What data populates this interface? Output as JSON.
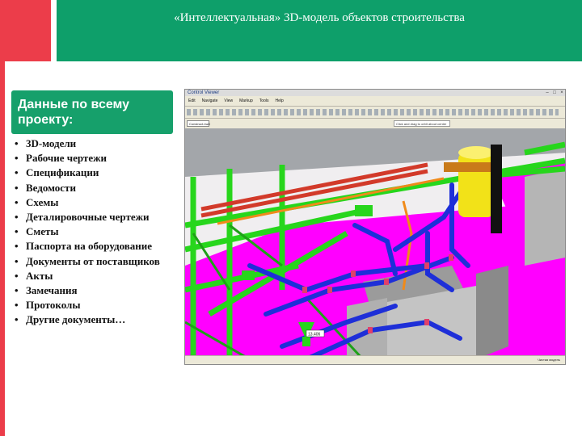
{
  "slide": {
    "title": "«Интеллектуальная» 3D-модель объектов строительства"
  },
  "panel": {
    "heading": "Данные по всему проекту:",
    "items": [
      {
        "label": "3D-модели"
      },
      {
        "label": "Рабочие чертежи"
      },
      {
        "label": "Спецификации"
      },
      {
        "label": "Ведомости"
      },
      {
        "label": "Схемы"
      },
      {
        "label": "Деталировочные чертежи"
      },
      {
        "label": "Сметы"
      },
      {
        "label": "Паспорта на оборудование"
      },
      {
        "label": "Документы от поставщиков"
      },
      {
        "label": "Акты"
      },
      {
        "label": "Замечания"
      },
      {
        "label": "Протоколы"
      },
      {
        "label": "Другие документы…"
      }
    ]
  },
  "viewer": {
    "title": "Control Viewer",
    "menu": [
      "Edit",
      "Navigate",
      "View",
      "Markup",
      "Tools",
      "Help"
    ],
    "file_tab": "Construct.nwd",
    "search_placeholder": "Click and drag to orbit about center",
    "status": "Чистая модель",
    "label_tag": "13.406"
  },
  "colors": {
    "header_green": "#0e9f6a",
    "accent_red": "#ec3d4a",
    "model_green": "#27d61c",
    "model_magenta": "#ff00ff",
    "model_blue": "#1e2fd8",
    "model_yellow": "#f2e218"
  }
}
